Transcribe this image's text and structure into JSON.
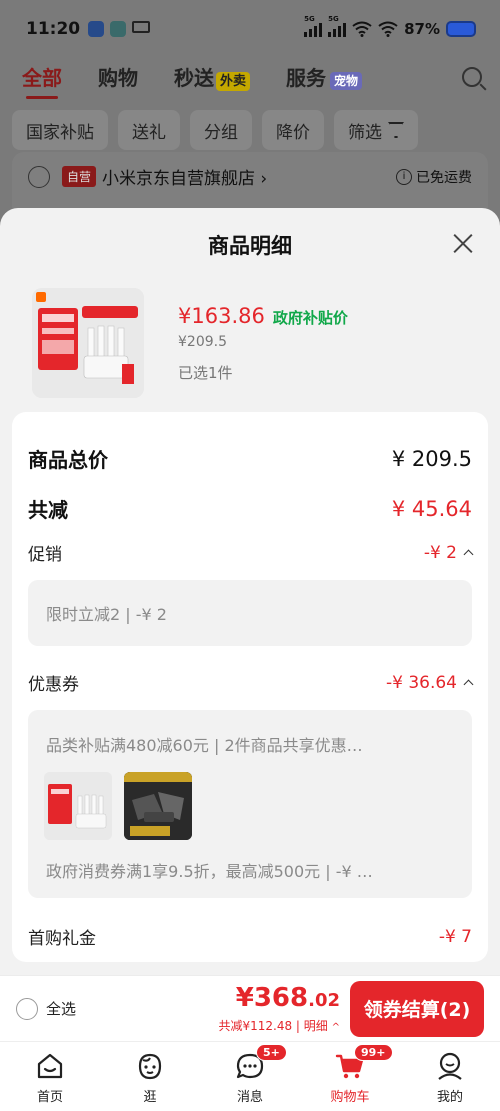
{
  "status_bar": {
    "time": "11:20",
    "battery": "87%",
    "net_1": "5G",
    "net_2": "5G"
  },
  "bg_page": {
    "tabs": [
      {
        "label": "全部"
      },
      {
        "label": "购物"
      },
      {
        "label": "秒送",
        "tag": "外卖"
      },
      {
        "label": "服务",
        "tag": "宠物"
      }
    ],
    "filters": [
      "国家补贴",
      "送礼",
      "分组",
      "降价",
      "筛选"
    ],
    "shop": {
      "badge": "自营",
      "name": "小米京东自营旗舰店 ›",
      "shipping": "已免运费"
    }
  },
  "sheet": {
    "title": "商品明细",
    "product": {
      "price": "¥163.86",
      "subsidy_tag": "政府补贴价",
      "original_price": "¥209.5",
      "selected": "已选1件"
    },
    "detail": {
      "total_label": "商品总价",
      "total_value": "¥ 209.5",
      "reduce_label": "共减",
      "reduce_value": "¥ 45.64",
      "promo_label": "促销",
      "promo_value": "-¥ 2",
      "promo_item": "限时立减2 | -¥ 2",
      "coupon_label": "优惠券",
      "coupon_value": "-¥ 36.64",
      "coupon_line1": "品类补贴满480减60元 | 2件商品共享优惠…",
      "coupon_line2": "政府消费券满1享9.5折，最高减500元 | -¥ …",
      "gift_label": "首购礼金",
      "gift_value": "-¥ 7"
    }
  },
  "checkout": {
    "select_all": "全选",
    "currency": "¥",
    "total_int": "368",
    "total_dec": ".02",
    "saved": "共减¥112.48 | 明细",
    "button": "领券结算(2)"
  },
  "tabbar": {
    "items": [
      {
        "label": "首页"
      },
      {
        "label": "逛"
      },
      {
        "label": "消息",
        "badge": "5+"
      },
      {
        "label": "购物车",
        "badge": "99+"
      },
      {
        "label": "我的"
      }
    ]
  },
  "colors": {
    "accent_red": "#e4262b",
    "subsidy_green": "#11a84a"
  }
}
